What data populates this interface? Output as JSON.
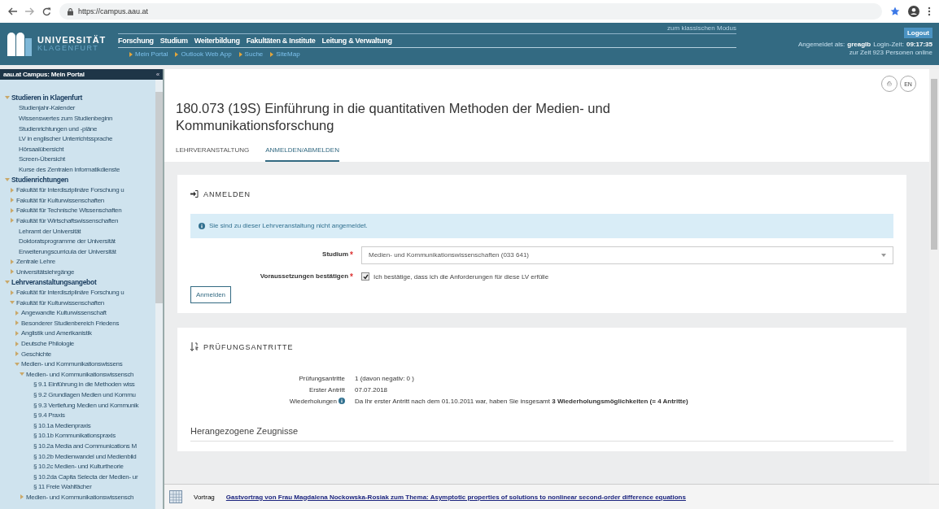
{
  "browser": {
    "url": "https://campus.aau.at"
  },
  "header": {
    "logo_line1": "UNIVERSITÄT",
    "logo_line2": "KLAGENFURT",
    "nav": [
      "Forschung",
      "Studium",
      "Weiterbildung",
      "Fakultäten & Institute",
      "Leitung & Verwaltung"
    ],
    "subnav": [
      "Mein Portal",
      "Outlook Web App",
      "Suche",
      "SiteMap"
    ],
    "classic_link": "zum klassischen Modus",
    "logout": "Logout",
    "login_label": "Angemeldet als:",
    "login_user": "greaglb",
    "login_time_label": "Login-Zeit:",
    "login_time": "09:17:35",
    "online": "zur Zeit 923 Personen online"
  },
  "sidebar": {
    "title": "aau.at Campus: Mein Portal",
    "collapse": "«",
    "tree": [
      {
        "label": "Studieren in Klagenfurt",
        "kind": "section",
        "expanded": true,
        "children": [
          {
            "label": "Studienjahr-Kalender",
            "kind": "link"
          },
          {
            "label": "Wissenswertes zum Studienbeginn",
            "kind": "link"
          },
          {
            "label": "Studienrichtungen und -pläne",
            "kind": "link"
          },
          {
            "label": "LV in englischer Unterrichtssprache",
            "kind": "link"
          },
          {
            "label": "Hörsaalübersicht",
            "kind": "link"
          },
          {
            "label": "Screen-Übersicht",
            "kind": "link"
          },
          {
            "label": "Kurse des Zentralen Informatikdienste",
            "kind": "link"
          }
        ]
      },
      {
        "label": "Studienrichtungen",
        "kind": "section",
        "expanded": true,
        "children": [
          {
            "label": "Fakultät für Interdisziplinäre Forschung u",
            "kind": "folder",
            "expanded": false
          },
          {
            "label": "Fakultät für Kulturwissenschaften",
            "kind": "folder",
            "expanded": false
          },
          {
            "label": "Fakultät für Technische Wissenschaften",
            "kind": "folder",
            "expanded": false
          },
          {
            "label": "Fakultät für Wirtschaftswissenschaften",
            "kind": "folder",
            "expanded": false
          },
          {
            "label": "Lehramt der Universität",
            "kind": "link"
          },
          {
            "label": "Doktoratsprogramme der Universität",
            "kind": "link"
          },
          {
            "label": "Erweiterungscurricula der Universität",
            "kind": "link"
          },
          {
            "label": "Zentrale Lehre",
            "kind": "folder",
            "expanded": false
          },
          {
            "label": "Universitätslehrgänge",
            "kind": "folder",
            "expanded": false
          }
        ]
      },
      {
        "label": "Lehrveranstaltungsangebot",
        "kind": "section",
        "expanded": true,
        "children": [
          {
            "label": "Fakultät für Interdisziplinäre Forschung u",
            "kind": "folder",
            "expanded": false
          },
          {
            "label": "Fakultät für Kulturwissenschaften",
            "kind": "folder",
            "expanded": true,
            "children": [
              {
                "label": "Angewandte Kulturwissenschaft",
                "kind": "folder",
                "expanded": false
              },
              {
                "label": "Besonderer Studienbereich Friedens",
                "kind": "folder",
                "expanded": false
              },
              {
                "label": "Anglistik und Amerikanistik",
                "kind": "folder",
                "expanded": false
              },
              {
                "label": "Deutsche Philologie",
                "kind": "folder",
                "expanded": false
              },
              {
                "label": "Geschichte",
                "kind": "folder",
                "expanded": false
              },
              {
                "label": "Medien- und Kommunikationswissens",
                "kind": "folder",
                "expanded": true,
                "children": [
                  {
                    "label": "Medien- und Kommunikationswissensch",
                    "kind": "folder",
                    "expanded": true,
                    "children": [
                      {
                        "label": "§ 9.1 Einführung in die Methoden wiss",
                        "kind": "link"
                      },
                      {
                        "label": "§ 9.2 Grundlagen Medien und Kommu",
                        "kind": "link"
                      },
                      {
                        "label": "§ 9.3 Vertiefung Medien und Kommunik",
                        "kind": "link"
                      },
                      {
                        "label": "§ 9.4 Praxis",
                        "kind": "link"
                      },
                      {
                        "label": "§ 10.1a Medienpraxis",
                        "kind": "link"
                      },
                      {
                        "label": "§ 10.1b Kommunikationspraxis",
                        "kind": "link"
                      },
                      {
                        "label": "§ 10.2a Media and Communications M",
                        "kind": "link"
                      },
                      {
                        "label": "§ 10.2b Medienwandel und Medienbild",
                        "kind": "link"
                      },
                      {
                        "label": "§ 10.2c Medien- und Kulturtheorie",
                        "kind": "link"
                      },
                      {
                        "label": "§ 10.2da Capita Selecta der Medien- ur",
                        "kind": "link"
                      },
                      {
                        "label": "§ 11 Freie Wahlfächer",
                        "kind": "link"
                      }
                    ]
                  },
                  {
                    "label": "Medien- und Kommunikationswissensch",
                    "kind": "folder",
                    "expanded": false
                  }
                ]
              }
            ]
          }
        ]
      }
    ]
  },
  "page": {
    "title": "180.073 (19S) Einführung in die quantitativen Methoden der Medien- und Kommunikationsforschung",
    "print": "⎙",
    "lang": "EN",
    "tabs": [
      {
        "label": "LEHRVERANSTALTUNG",
        "selected": false
      },
      {
        "label": "ANMELDEN/ABMELDEN",
        "selected": true
      }
    ]
  },
  "register": {
    "heading": "ANMELDEN",
    "info": "Sie sind zu dieser Lehrveranstaltung nicht angemeldet.",
    "study_label": "Studium",
    "study_value": "Medien- und Kommunikationswissenschaften (033 641)",
    "confirm_label": "Voraussetzungen bestätigen",
    "confirm_text": "Ich bestätige, dass ich die Anforderungen für diese LV erfülle",
    "confirm_checked": true,
    "required_mark": "*",
    "button": "Anmelden"
  },
  "exams": {
    "heading": "PRÜFUNGSANTRITTE",
    "rows": [
      {
        "label": "Prüfungsantritte",
        "value": "1 (davon negativ: 0 )",
        "info": false
      },
      {
        "label": "Erster Antritt",
        "value": "07.07.2018",
        "info": false
      },
      {
        "label": "Wiederholungen",
        "value": "Da Ihr erster Antritt nach dem 01.10.2011 war, haben Sie insgesamt **3 Wiederholungsmöglichkeiten (= 4 Antritte)**",
        "info": true
      }
    ],
    "subheading": "Herangezogene Zeugnisse"
  },
  "notice": {
    "type": "Vortrag",
    "link": "Gastvortrag von Frau Magdalena Nockowska-Rosiak zum Thema: Asymptotic properties of solutions to nonlinear second-order difference equations"
  }
}
